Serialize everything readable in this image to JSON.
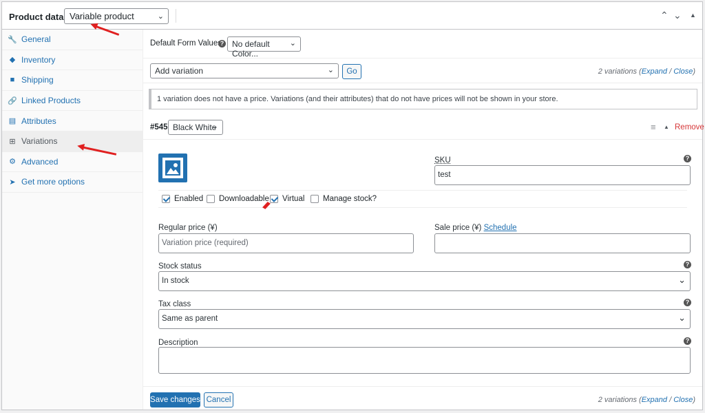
{
  "header": {
    "title": "Product data —",
    "product_type": "Variable product",
    "controls": [
      "up-icon",
      "down-icon",
      "collapse-icon"
    ]
  },
  "sidebar": {
    "items": [
      {
        "label": "General",
        "icon": "wrench-icon"
      },
      {
        "label": "Inventory",
        "icon": "tag-icon"
      },
      {
        "label": "Shipping",
        "icon": "truck-icon"
      },
      {
        "label": "Linked Products",
        "icon": "link-icon"
      },
      {
        "label": "Attributes",
        "icon": "list-icon"
      },
      {
        "label": "Variations",
        "icon": "grid-icon",
        "active": true
      },
      {
        "label": "Advanced",
        "icon": "gear-icon"
      },
      {
        "label": "Get more options",
        "icon": "plugin-icon"
      }
    ]
  },
  "defaults": {
    "label": "Default Form Values:",
    "select_value": "No default Color..."
  },
  "add_variation": {
    "select_value": "Add variation",
    "go_label": "Go"
  },
  "var_count": {
    "text": "2 variations (",
    "expand": "Expand",
    "sep": " / ",
    "close": "Close",
    "end": ")"
  },
  "notice": "1 variation does not have a price. Variations (and their attributes) that do not have prices will not be shown in your store.",
  "variation": {
    "id": "#545",
    "attribute_value": "Black White",
    "remove_label": "Remove",
    "sku_label": "SKU",
    "sku_value": "test",
    "checkboxes": [
      {
        "label": "Enabled",
        "checked": true
      },
      {
        "label": "Downloadable",
        "checked": false
      },
      {
        "label": "Virtual",
        "checked": true
      },
      {
        "label": "Manage stock?",
        "checked": false
      }
    ],
    "regular_price_label": "Regular price (¥)",
    "regular_price_placeholder": "Variation price (required)",
    "sale_price_label": "Sale price (¥)",
    "schedule_label": "Schedule",
    "stock_status_label": "Stock status",
    "stock_status_value": "In stock",
    "tax_class_label": "Tax class",
    "tax_class_value": "Same as parent",
    "description_label": "Description"
  },
  "footer": {
    "save_label": "Save changes",
    "cancel_label": "Cancel"
  },
  "colors": {
    "accent": "#2271b1",
    "danger": "#d63638",
    "annotation": "#e02020"
  }
}
